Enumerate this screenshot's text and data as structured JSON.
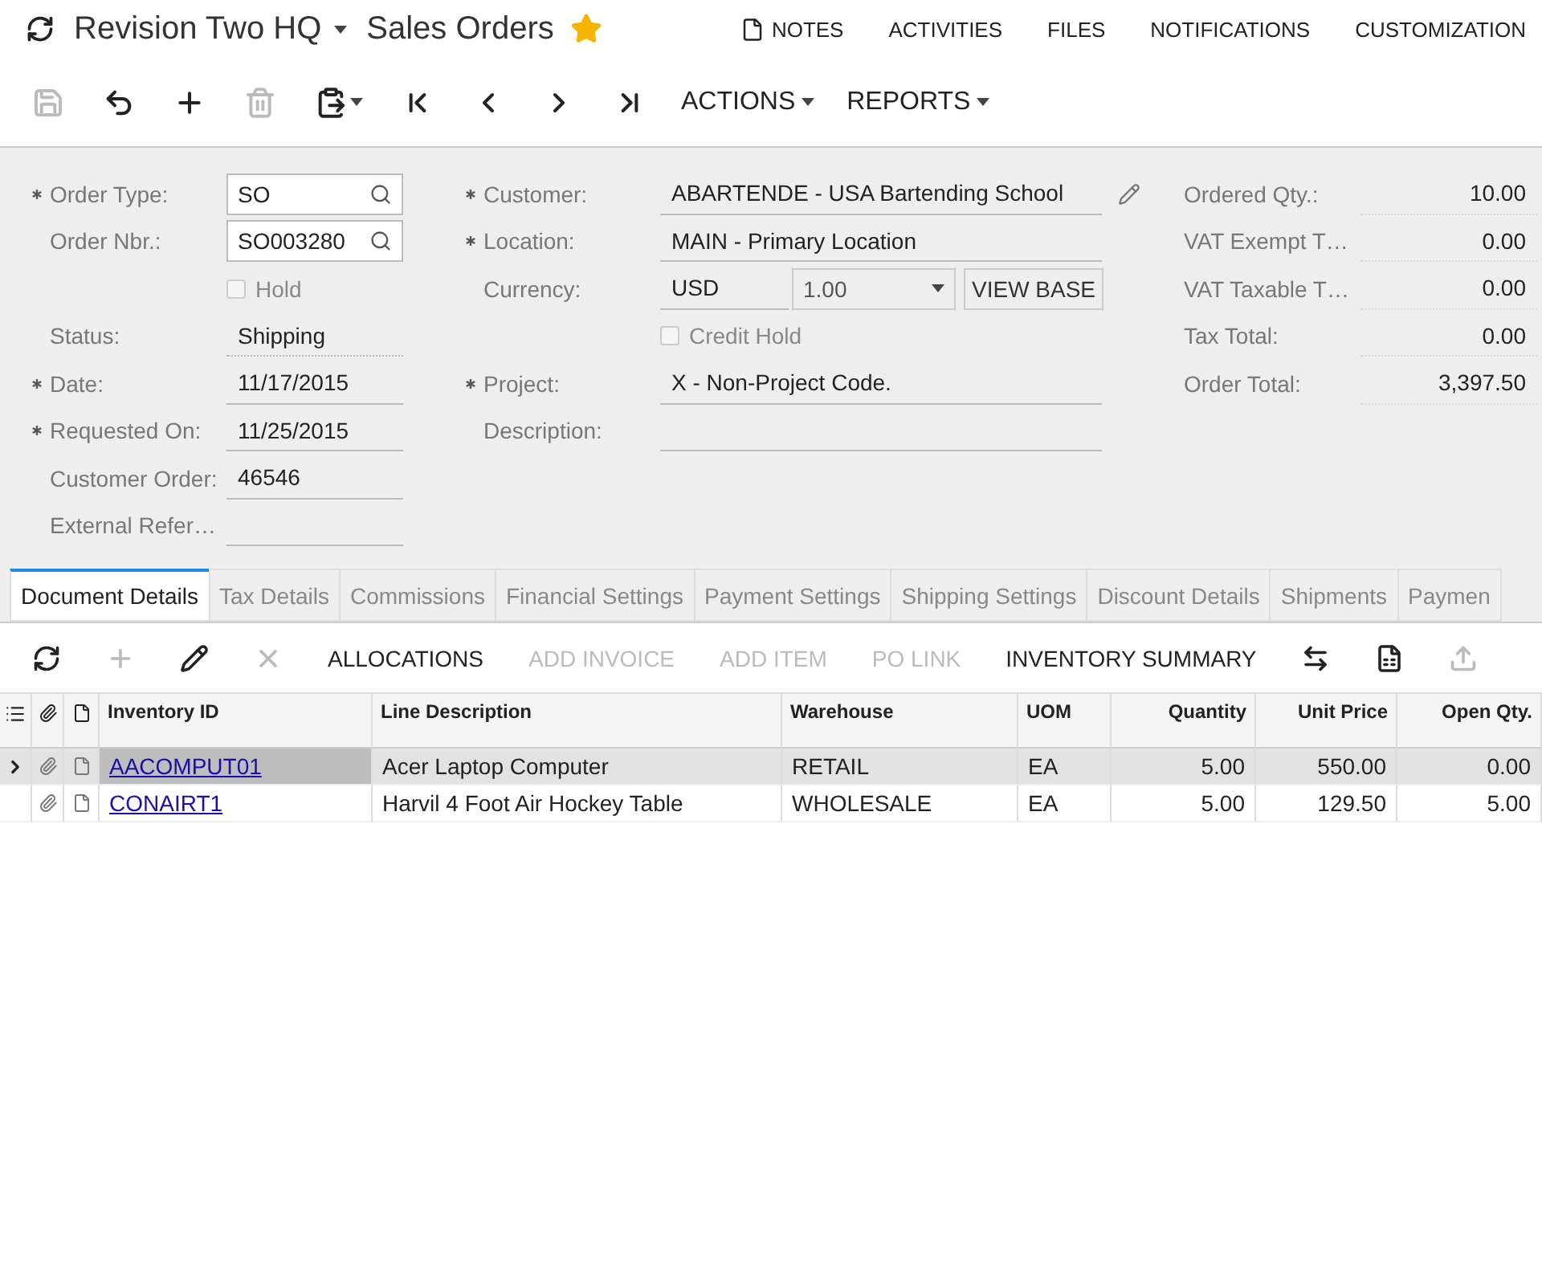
{
  "header": {
    "company": "Revision Two HQ",
    "screen": "Sales Orders",
    "favorite": true,
    "links": [
      {
        "label": "NOTES",
        "kind": "notes"
      },
      {
        "label": "ACTIVITIES",
        "kind": "plain"
      },
      {
        "label": "FILES",
        "kind": "plain"
      },
      {
        "label": "NOTIFICATIONS",
        "kind": "plain"
      },
      {
        "label": "CUSTOMIZATION",
        "kind": "plain"
      }
    ]
  },
  "toolbar": {
    "buttons": [
      {
        "kind": "save",
        "disabled": true
      },
      {
        "kind": "undo",
        "disabled": false
      },
      {
        "kind": "add",
        "disabled": false
      },
      {
        "kind": "delete",
        "disabled": true
      },
      {
        "kind": "paste",
        "disabled": false
      },
      {
        "kind": "first",
        "disabled": false
      },
      {
        "kind": "prev",
        "disabled": false
      },
      {
        "kind": "next",
        "disabled": false
      },
      {
        "kind": "last",
        "disabled": false
      }
    ],
    "menus": [
      "ACTIONS",
      "REPORTS"
    ]
  },
  "form": {
    "left": [
      {
        "kind": "lookup",
        "label": "Order Type:",
        "required": true,
        "value": "SO"
      },
      {
        "kind": "lookup",
        "label": "Order Nbr.:",
        "required": false,
        "value": "SO003280"
      },
      {
        "kind": "checkbox",
        "label": "Hold",
        "checked": false
      },
      {
        "kind": "readonly",
        "label": "Status:",
        "required": false,
        "value": "Shipping"
      },
      {
        "kind": "text",
        "label": "Date:",
        "required": true,
        "value": "11/17/2015"
      },
      {
        "kind": "text",
        "label": "Requested On:",
        "required": true,
        "value": "11/25/2015"
      },
      {
        "kind": "text",
        "label": "Customer Order:",
        "required": false,
        "value": "46546"
      },
      {
        "kind": "text",
        "label": "External Refer…",
        "required": false
      }
    ],
    "middle": [
      {
        "kind": "edit",
        "label": "Customer:",
        "required": true,
        "value": "ABARTENDE - USA Bartending School"
      },
      {
        "kind": "text",
        "label": "Location:",
        "required": true,
        "value": "MAIN - Primary Location"
      },
      {
        "kind": "currency",
        "label": "Currency:",
        "required": false,
        "value": "USD",
        "rate": "1.00",
        "button": "VIEW BASE"
      },
      {
        "kind": "checkbox",
        "label": "Credit Hold",
        "checked": false
      },
      {
        "kind": "text",
        "label": "Project:",
        "required": true,
        "value": "X - Non-Project Code."
      },
      {
        "kind": "text",
        "label": "Description:",
        "required": false
      }
    ],
    "totals": [
      {
        "label": "Ordered Qty.:",
        "value": "10.00"
      },
      {
        "label": "VAT Exempt T…",
        "value": "0.00"
      },
      {
        "label": "VAT Taxable T…",
        "value": "0.00"
      },
      {
        "label": "Tax Total:",
        "value": "0.00"
      },
      {
        "label": "Order Total:",
        "value": "3,397.50"
      }
    ]
  },
  "tabs": [
    {
      "label": "Document Details",
      "selected": true
    },
    {
      "label": "Tax Details",
      "selected": false
    },
    {
      "label": "Commissions",
      "selected": false
    },
    {
      "label": "Financial Settings",
      "selected": false
    },
    {
      "label": "Payment Settings",
      "selected": false
    },
    {
      "label": "Shipping Settings",
      "selected": false
    },
    {
      "label": "Discount Details",
      "selected": false
    },
    {
      "label": "Shipments",
      "selected": false
    },
    {
      "label": "Paymen",
      "selected": false
    }
  ],
  "grid_toolbar": [
    {
      "kind": "refresh",
      "disabled": false
    },
    {
      "kind": "add",
      "disabled": true
    },
    {
      "kind": "edit",
      "disabled": false
    },
    {
      "kind": "delete",
      "disabled": true
    },
    {
      "kind": "text",
      "label": "ALLOCATIONS",
      "disabled": false
    },
    {
      "kind": "text",
      "label": "ADD INVOICE",
      "disabled": true
    },
    {
      "kind": "text",
      "label": "ADD ITEM",
      "disabled": true
    },
    {
      "kind": "text",
      "label": "PO LINK",
      "disabled": true
    },
    {
      "kind": "text",
      "label": "INVENTORY SUMMARY",
      "disabled": false
    },
    {
      "kind": "fit",
      "disabled": false
    },
    {
      "kind": "excel",
      "disabled": false
    },
    {
      "kind": "upload",
      "disabled": true
    }
  ],
  "grid": {
    "columns": [
      {
        "label": "Inventory ID",
        "kind": "text"
      },
      {
        "label": "Line Description",
        "kind": "text"
      },
      {
        "label": "Warehouse",
        "kind": "text"
      },
      {
        "label": "UOM",
        "kind": "text"
      },
      {
        "label": "Quantity",
        "kind": "number"
      },
      {
        "label": "Unit Price",
        "kind": "number"
      },
      {
        "label": "Open Qty.",
        "kind": "number"
      }
    ],
    "rows": [
      {
        "selected": true,
        "cells": [
          "AACOMPUT01",
          "Acer Laptop Computer",
          "RETAIL",
          "EA",
          "5.00",
          "550.00",
          "0.00"
        ]
      },
      {
        "selected": false,
        "cells": [
          "CONAIRT1",
          "Harvil 4 Foot Air Hockey Table",
          "WHOLESALE",
          "EA",
          "5.00",
          "129.50",
          "5.00"
        ]
      }
    ]
  }
}
